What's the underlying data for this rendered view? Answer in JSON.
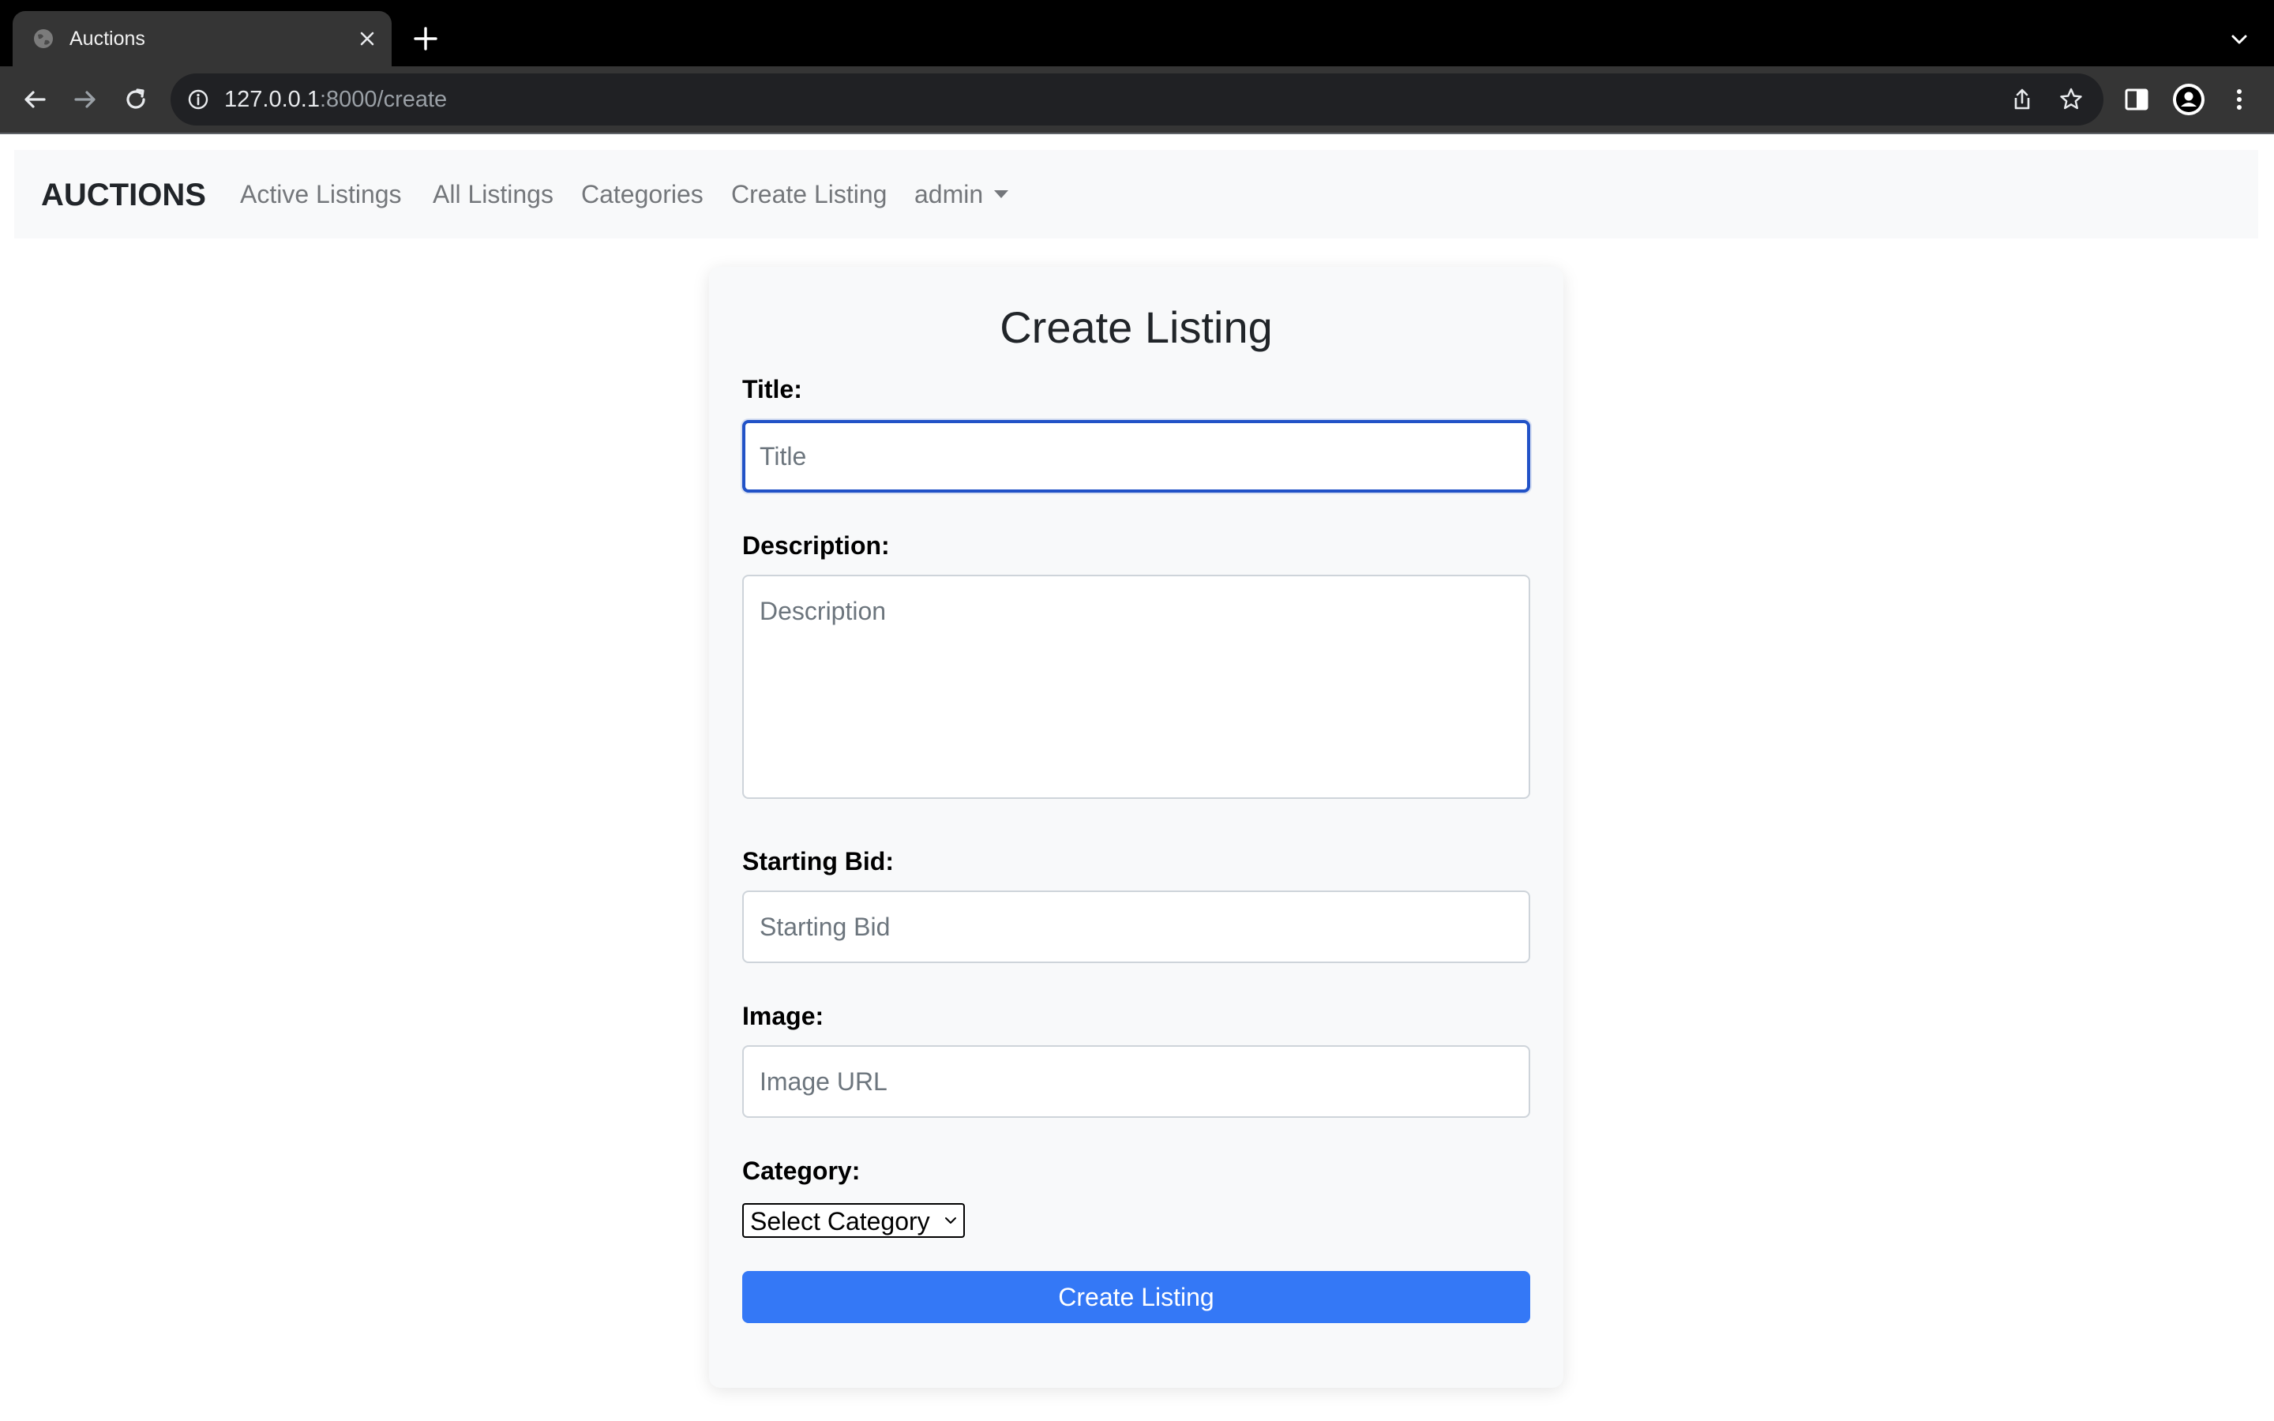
{
  "browser": {
    "tab_title": "Auctions",
    "url_host": "127.0.0.1",
    "url_rest": ":8000/create"
  },
  "navbar": {
    "brand": "AUCTIONS",
    "links": [
      "Active Listings",
      "All Listings",
      "Categories",
      "Create Listing"
    ],
    "user": "admin"
  },
  "form": {
    "heading": "Create Listing",
    "title_label": "Title:",
    "title_placeholder": "Title",
    "description_label": "Description:",
    "description_placeholder": "Description",
    "starting_bid_label": "Starting Bid:",
    "starting_bid_placeholder": "Starting Bid",
    "image_label": "Image:",
    "image_placeholder": "Image URL",
    "category_label": "Category:",
    "category_selected": "Select Category",
    "submit_label": "Create Listing"
  },
  "colors": {
    "primary_button": "#3478f6",
    "focus_border": "#2152c7",
    "navbar_bg": "#f8f9fa"
  }
}
